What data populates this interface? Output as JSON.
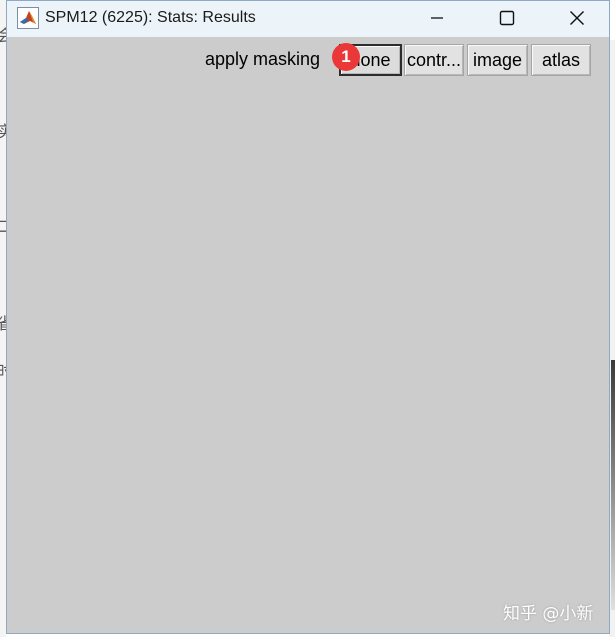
{
  "background": {
    "left_chars": [
      "会",
      "实",
      "二",
      "省",
      "时"
    ]
  },
  "window": {
    "title": "SPM12 (6225): Stats: Results",
    "app_icon": "matlab-logo-icon",
    "controls": {
      "minimize": "minimize-icon",
      "maximize": "maximize-icon",
      "close": "close-icon"
    }
  },
  "masking": {
    "label": "apply masking",
    "options": [
      {
        "label": "none",
        "selected": true
      },
      {
        "label": "contr...",
        "selected": false
      },
      {
        "label": "image",
        "selected": false
      },
      {
        "label": "atlas",
        "selected": false
      }
    ]
  },
  "annotation": {
    "badge": "1",
    "color": "#ea3838"
  },
  "watermark": "知乎 @小新",
  "colors": {
    "titlebar": "#edf4f9",
    "window_bg": "#cccccc",
    "button_bg": "#e2e2e2"
  }
}
